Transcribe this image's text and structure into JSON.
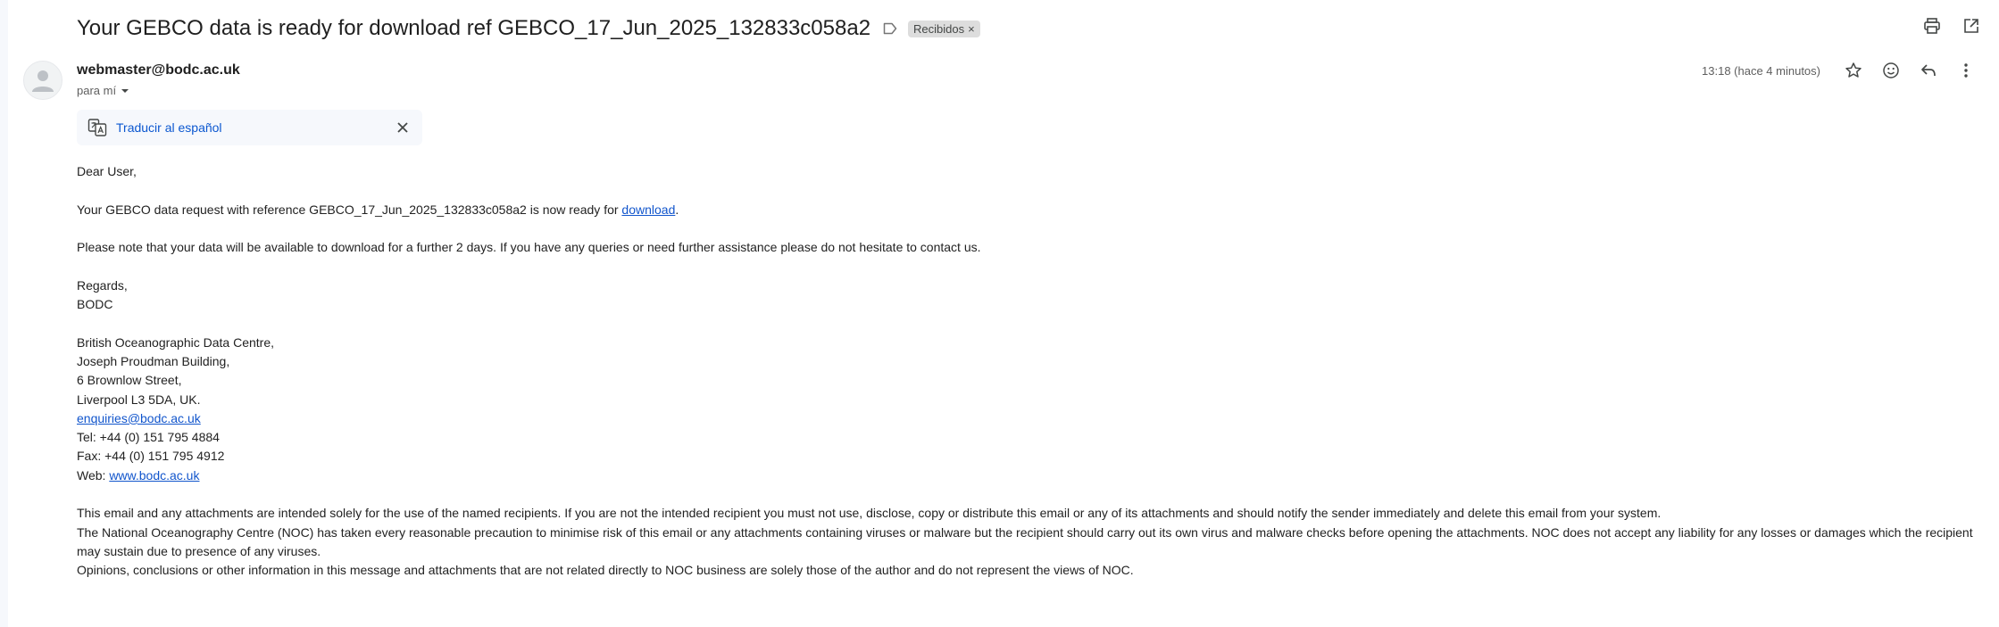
{
  "subject": {
    "title": "Your GEBCO data is ready for download ref GEBCO_17_Jun_2025_132833c058a2",
    "inbox_chip": "Recibidos",
    "chip_close": "×"
  },
  "sender": {
    "email": "webmaster@bodc.ac.uk",
    "to_me": "para mí",
    "time": "13:18 (hace 4 minutos)"
  },
  "translate": {
    "link": "Traducir al español"
  },
  "body": {
    "greeting": "Dear User,",
    "line1_pre": "Your GEBCO data request with reference GEBCO_17_Jun_2025_132833c058a2 is now ready for ",
    "line1_link": "download",
    "line1_post": ".",
    "line2": "Please note that your data will be available to download for a further 2 days. If you have any queries or need further assistance please do not hesitate to contact us.",
    "regards": "Regards,",
    "signoff": "BODC",
    "addr1": "British Oceanographic Data Centre,",
    "addr2": "Joseph Proudman Building,",
    "addr3": "6 Brownlow Street,",
    "addr4": "Liverpool L3 5DA, UK.",
    "contact_email": "enquiries@bodc.ac.uk",
    "tel": "Tel: +44 (0) 151 795 4884",
    "fax": "Fax: +44 (0) 151 795 4912",
    "web_prefix": "Web: ",
    "web_link": "www.bodc.ac.uk",
    "disclaimer1": "This email and any attachments are intended solely for the use of the named recipients. If you are not the intended recipient you must not use, disclose, copy or distribute this email or any of its attachments and should notify the sender immediately and delete this email from your system.",
    "disclaimer2": "The National Oceanography Centre (NOC) has taken every reasonable precaution to minimise risk of this email or any attachments containing viruses or malware but the recipient should carry out its own virus and malware checks before opening the attachments. NOC does not accept any liability for any losses or damages which the recipient may sustain due to presence of any viruses.",
    "disclaimer3": "Opinions, conclusions or other information in this message and attachments that are not related directly to NOC business are solely those of the author and do not represent the views of NOC."
  },
  "icons": {
    "label": "label-outline-icon",
    "print": "print-icon",
    "open_new": "open-in-new-window-icon",
    "star": "star-icon",
    "emoji": "emoji-reaction-icon",
    "reply": "reply-icon",
    "more": "more-vert-icon",
    "translate": "translate-icon",
    "close": "close-icon",
    "avatar": "default-avatar-icon",
    "dropdown": "dropdown-arrow-icon"
  },
  "colors": {
    "link": "#0b57d0",
    "body_link": "#1155cc",
    "chip_bg": "#dddddd",
    "translate_bg": "#f6f8fc"
  }
}
